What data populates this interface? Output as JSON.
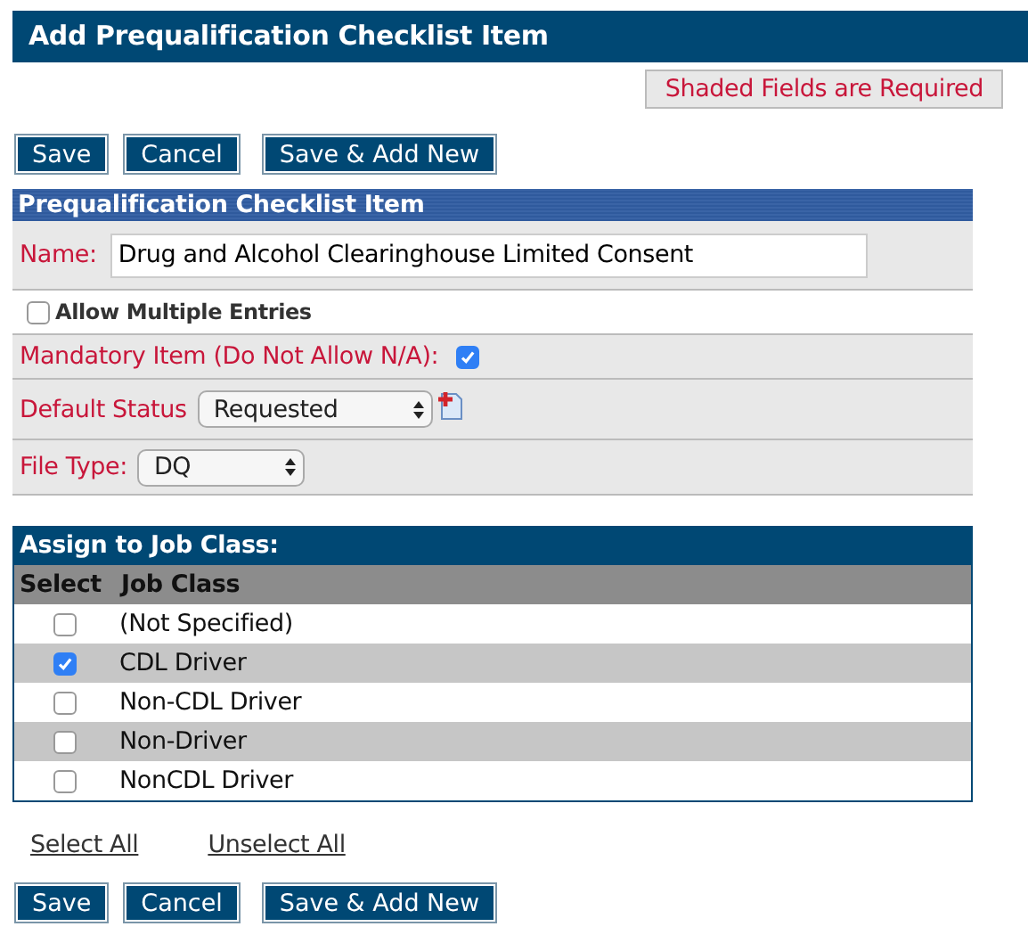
{
  "header": {
    "title": "Add Prequalification Checklist Item"
  },
  "required_note": "Shaded Fields are Required",
  "top_buttons": [
    "Save",
    "Cancel",
    "Save & Add New"
  ],
  "section": {
    "title": "Prequalification Checklist Item",
    "fields": [
      {
        "kind": "text",
        "label": "Name:",
        "value": "Drug and Alcohol Clearinghouse Limited Consent",
        "required": true
      },
      {
        "kind": "checkbox",
        "label": "Allow Multiple Entries",
        "checked": false,
        "required": false
      },
      {
        "kind": "check-after",
        "label": "Mandatory Item (Do Not Allow N/A):",
        "checked": true,
        "required": true
      },
      {
        "kind": "select",
        "label": "Default Status",
        "value": "Requested",
        "add_icon": true,
        "required": true
      },
      {
        "kind": "select",
        "label": "File Type:",
        "value": "DQ",
        "required": true
      }
    ]
  },
  "job_class": {
    "title": "Assign to Job Class:",
    "columns": [
      "Select",
      "Job Class"
    ],
    "rows": [
      {
        "name": "(Not Specified)",
        "checked": false
      },
      {
        "name": "CDL Driver",
        "checked": true
      },
      {
        "name": "Non-CDL Driver",
        "checked": false
      },
      {
        "name": "Non-Driver",
        "checked": false
      },
      {
        "name": "NonCDL Driver",
        "checked": false
      }
    ]
  },
  "links": [
    "Select All",
    "Unselect All"
  ],
  "bottom_buttons": [
    "Save",
    "Cancel",
    "Save & Add New"
  ]
}
